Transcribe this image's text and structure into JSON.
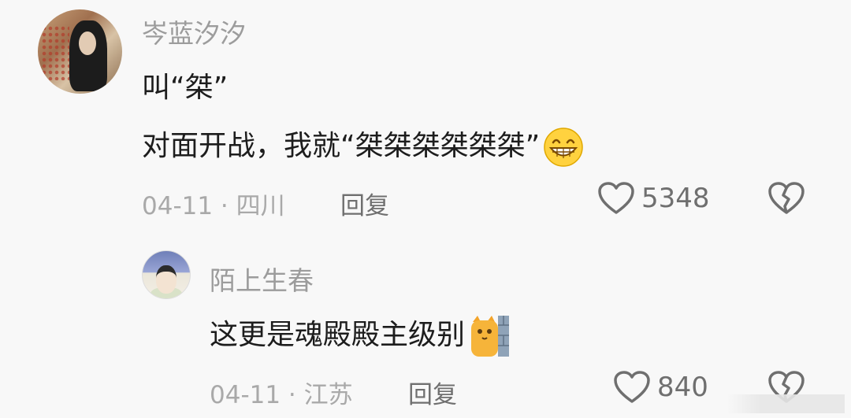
{
  "comments": {
    "main": {
      "username": "岑蓝汐汐",
      "line1": "叫“桀”",
      "line2": "对面开战，我就“桀桀桀桀桀桀”",
      "emoji": "grin-emoji",
      "date_location": "04-11 · 四川",
      "reply_label": "回复",
      "like_count": "5348"
    },
    "reply": {
      "username": "陌上生春",
      "text": "这更是魂殿殿主级别",
      "emoji": "cat-peek-emoji",
      "date_location": "04-11 · 江苏",
      "reply_label": "回复",
      "like_count": "840"
    }
  },
  "colors": {
    "background": "#f8f8f8",
    "username": "#9c9c9c",
    "content": "#1d1d1d",
    "meta": "#a9a9a9",
    "icon": "#6f6f6f"
  }
}
